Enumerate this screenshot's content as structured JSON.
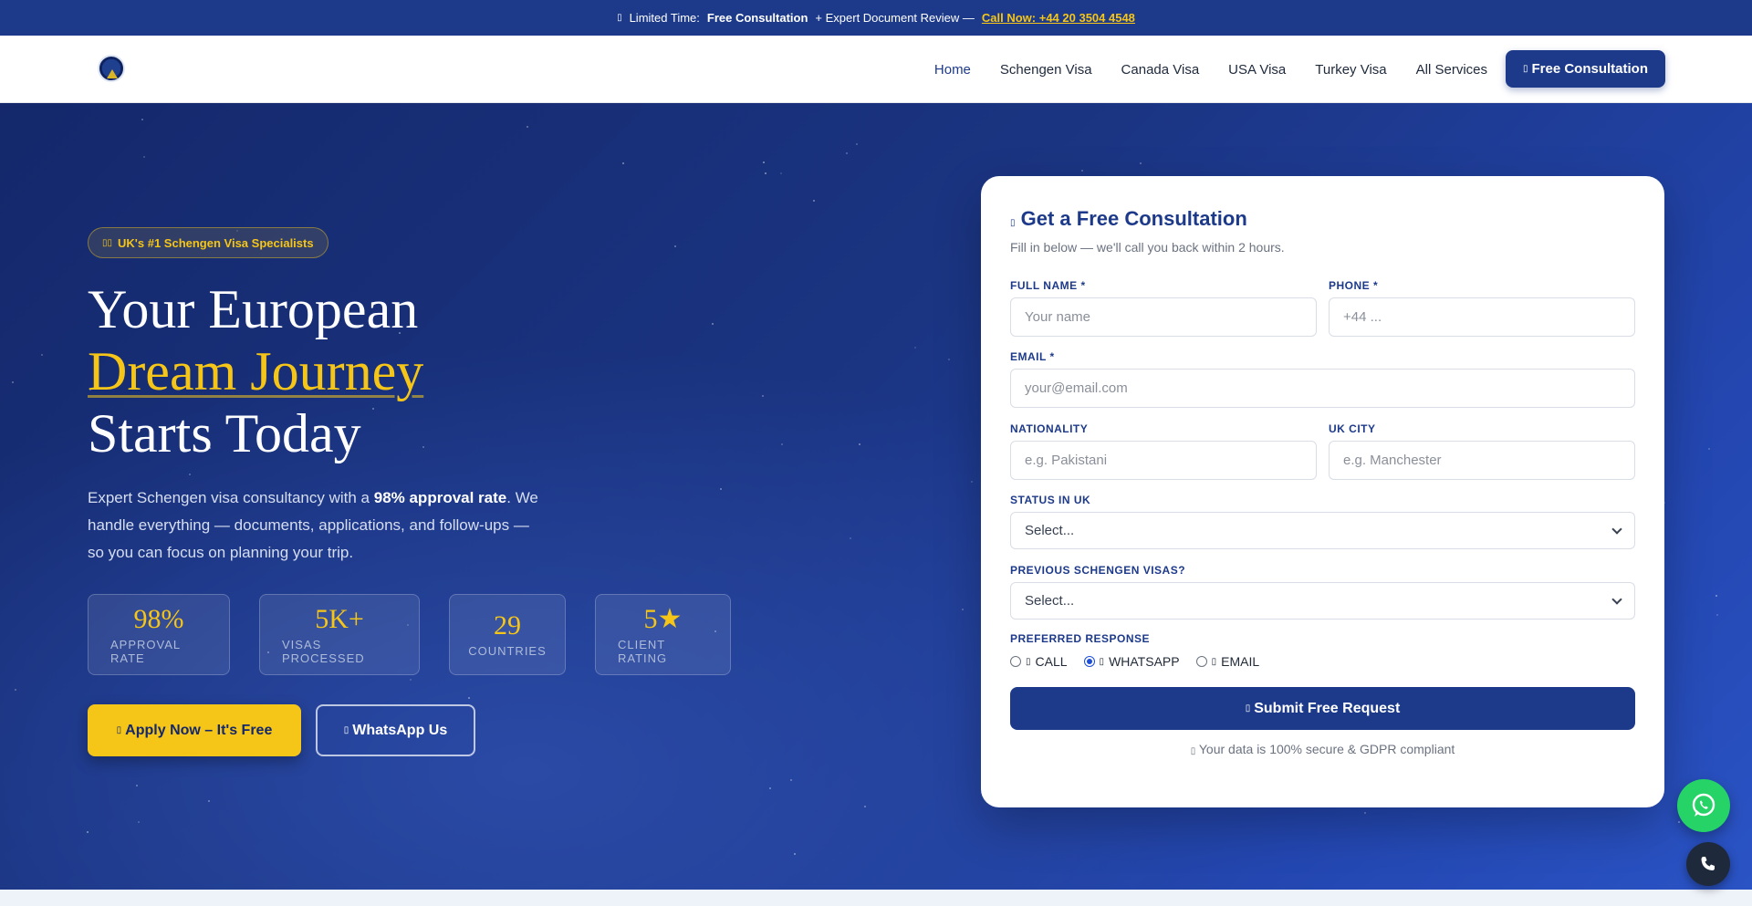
{
  "announcement": {
    "icon": "clock-icon",
    "prefix": "Limited Time:",
    "offer": "Free Consultation",
    "extra": "+ Expert Document Review —",
    "call_link": "Call Now: +44 20 3504 4548"
  },
  "nav": {
    "links": [
      "Home",
      "Schengen Visa",
      "Canada Visa",
      "USA Visa",
      "Turkey Visa",
      "All Services"
    ],
    "active": "Home",
    "cta_label": "Free Consultation"
  },
  "hero": {
    "badge": "UK's #1 Schengen Visa Specialists",
    "headline_line1": "Your European",
    "headline_highlight": "Dream Journey",
    "headline_line3": "Starts Today",
    "sub_before": "Expert Schengen visa consultancy with a ",
    "sub_bold": "98% approval rate",
    "sub_after": ". We handle everything — documents, applications, and follow-ups — so you can focus on planning your trip.",
    "stats": [
      {
        "value": "98%",
        "label": "APPROVAL RATE"
      },
      {
        "value": "5K+",
        "label": "VISAS PROCESSED"
      },
      {
        "value": "29",
        "label": "COUNTRIES"
      },
      {
        "value": "5★",
        "label": "CLIENT RATING"
      }
    ],
    "apply_label": "Apply Now – It's Free",
    "whatsapp_label": "WhatsApp Us"
  },
  "form": {
    "title": "Get a Free Consultation",
    "subtitle": "Fill in below — we'll call you back within 2 hours.",
    "full_name_label": "FULL NAME *",
    "full_name_placeholder": "Your name",
    "phone_label": "PHONE *",
    "phone_placeholder": "+44 ...",
    "email_label": "EMAIL *",
    "email_placeholder": "your@email.com",
    "nationality_label": "NATIONALITY",
    "nationality_placeholder": "e.g. Pakistani",
    "city_label": "UK CITY",
    "city_placeholder": "e.g. Manchester",
    "status_label": "STATUS IN UK",
    "status_value": "Select...",
    "previous_label": "PREVIOUS SCHENGEN VISAS?",
    "previous_value": "Select...",
    "response_label": "PREFERRED RESPONSE",
    "response_options": [
      "CALL",
      "WHATSAPP",
      "EMAIL"
    ],
    "response_selected": "WHATSAPP",
    "submit_label": "Submit Free Request",
    "secure_note": "Your data is 100% secure & GDPR compliant"
  },
  "colors": {
    "navy": "#1d3a8a",
    "gold": "#f5c518",
    "whatsapp_green": "#25d366"
  }
}
